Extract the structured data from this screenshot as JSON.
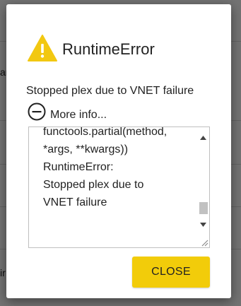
{
  "background": {
    "row_fragments": [
      "ar",
      "",
      "",
      "",
      "",
      "ir"
    ]
  },
  "dialog": {
    "icon": "warning-triangle-icon",
    "icon_color": "#f2c811",
    "title": "RuntimeError",
    "message": "Stopped plex due to VNET failure",
    "more_info_icon": "minus-circle-icon",
    "more_info_label": "More info...",
    "details_text": "functools.partial(method,\n*args, **kwargs))\nRuntimeError:\nStopped plex due to\nVNET failure",
    "close_label": "CLOSE",
    "close_color": "#f2cc0a"
  }
}
